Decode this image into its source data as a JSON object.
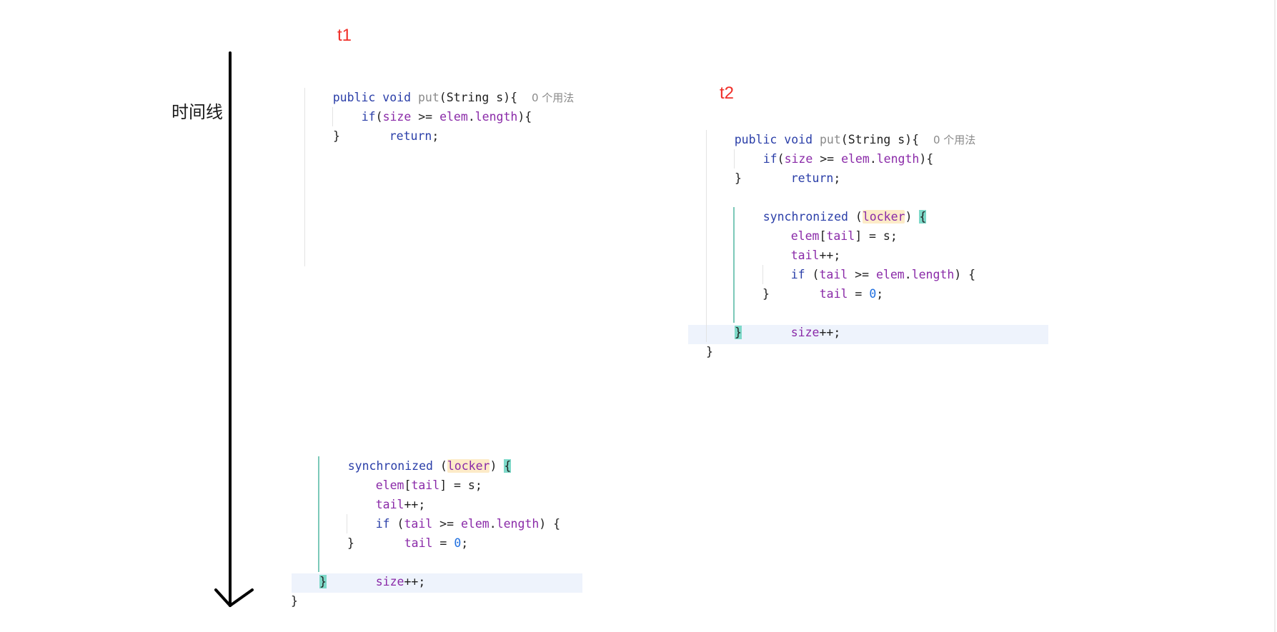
{
  "labels": {
    "t1": "t1",
    "t2": "t2",
    "timeline": "时间线"
  },
  "t1_top": {
    "l1": {
      "kw": "public void",
      "fn": "put",
      "rest": "(String s){",
      "hint": "0 个用法"
    },
    "l2": {
      "kw": "if",
      "p1": "(",
      "f1": "size",
      "op": " >= ",
      "f2": "elem",
      "dot": ".",
      "f3": "length",
      "end": "){"
    },
    "l3": {
      "kw": "return",
      "end": ";"
    },
    "l4": "}"
  },
  "t2": {
    "l1": {
      "kw": "public void",
      "fn": "put",
      "rest": "(String s){",
      "hint": "0 个用法"
    },
    "l2": {
      "kw": "if",
      "p1": "(",
      "f1": "size",
      "op": " >= ",
      "f2": "elem",
      "dot": ".",
      "f3": "length",
      "end": "){"
    },
    "l3": {
      "kw": "return",
      "end": ";"
    },
    "l4": "}",
    "l5": {
      "kw": "synchronized",
      "p1": " (",
      "lock": "locker",
      "p2": ") ",
      "brace": "{"
    },
    "l6": {
      "f1": "elem",
      "b1": "[",
      "f2": "tail",
      "b2": "] = s;"
    },
    "l7": {
      "f1": "tail",
      "end": "++;"
    },
    "l8": {
      "kw": "if",
      "p1": " (",
      "f1": "tail",
      "op": " >= ",
      "f2": "elem",
      "dot": ".",
      "f3": "length",
      "end": ") {"
    },
    "l9": {
      "f1": "tail",
      "op": " = ",
      "num": "0",
      "end": ";"
    },
    "l10": "}",
    "l11": {
      "f1": "size",
      "end": "++;"
    },
    "l12": "}",
    "l13": "}"
  },
  "t1_bottom": {
    "l1": {
      "kw": "synchronized",
      "p1": " (",
      "lock": "locker",
      "p2": ") ",
      "brace": "{"
    },
    "l2": {
      "f1": "elem",
      "b1": "[",
      "f2": "tail",
      "b2": "] = s;"
    },
    "l3": {
      "f1": "tail",
      "end": "++;"
    },
    "l4": {
      "kw": "if",
      "p1": " (",
      "f1": "tail",
      "op": " >= ",
      "f2": "elem",
      "dot": ".",
      "f3": "length",
      "end": ") {"
    },
    "l5": {
      "f1": "tail",
      "op": " = ",
      "num": "0",
      "end": ";"
    },
    "l6": "}",
    "l7": {
      "f1": "size",
      "end": "++;"
    },
    "l8": "}",
    "l9": "}"
  },
  "colors": {
    "thread_label": "#f0302a",
    "keyword": "#2a3ea8",
    "method": "#8a8a8a",
    "field": "#8a2aa8",
    "number": "#1f6fe0",
    "lock_highlight": "#fdebc8",
    "brace_highlight": "#7ed9c9",
    "line_highlight": "#eef3fc"
  }
}
